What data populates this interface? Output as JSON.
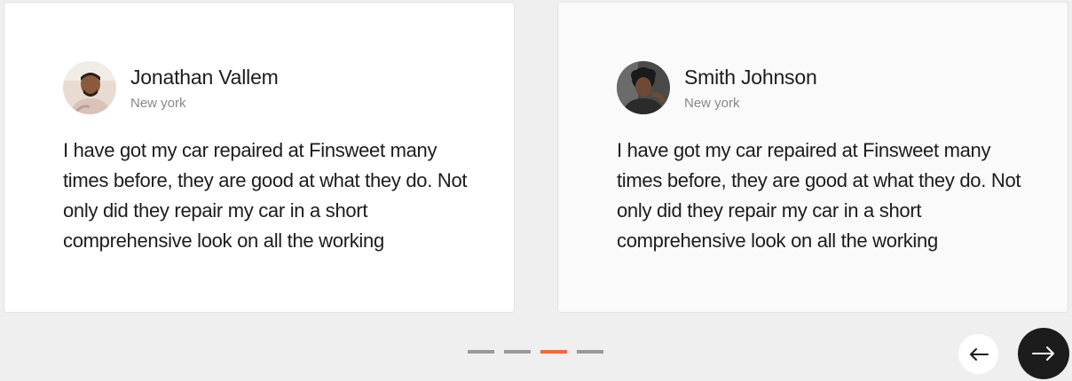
{
  "testimonials": [
    {
      "name": "Jonathan Vallem",
      "location": "New york",
      "avatar_icon": "avatar-photo",
      "quote": "I have got my car repaired at Finsweet many times before, they are good at what they do. Not only did they repair my car in a short comprehensive look on all the working"
    },
    {
      "name": "Smith Johnson",
      "location": "New york",
      "avatar_icon": "avatar-photo",
      "quote": "I have got my car repaired at Finsweet many times before, they are good at what they do. Not only did they repair my car in a short comprehensive look on all the working"
    }
  ],
  "pagination": {
    "total": 4,
    "active_index": 2,
    "active_color": "#ee6a3f",
    "inactive_color": "#999999"
  },
  "navigation": {
    "prev_icon": "arrow-left-icon",
    "next_icon": "arrow-right-icon"
  },
  "colors": {
    "background": "#efefef",
    "card": "#ffffff",
    "text": "#1c1c1c",
    "muted": "#888888",
    "next_button": "#1c1c1c"
  }
}
